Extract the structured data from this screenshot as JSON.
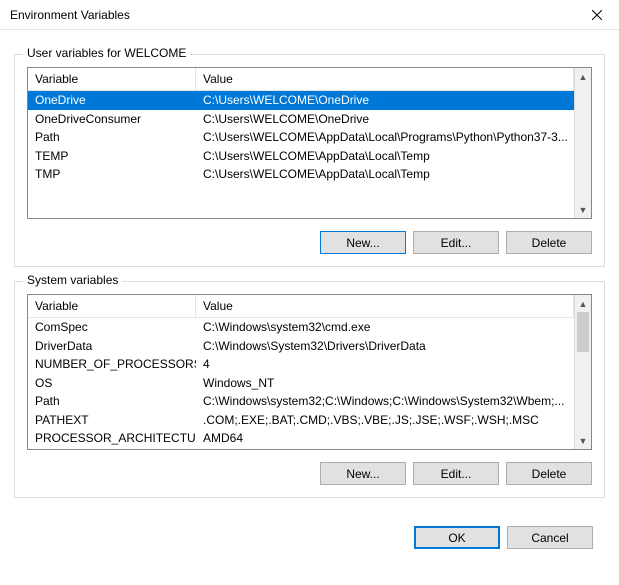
{
  "window": {
    "title": "Environment Variables"
  },
  "user": {
    "legend": "User variables for WELCOME",
    "header_var": "Variable",
    "header_val": "Value",
    "rows": [
      {
        "name": "OneDrive",
        "value": "C:\\Users\\WELCOME\\OneDrive"
      },
      {
        "name": "OneDriveConsumer",
        "value": "C:\\Users\\WELCOME\\OneDrive"
      },
      {
        "name": "Path",
        "value": "C:\\Users\\WELCOME\\AppData\\Local\\Programs\\Python\\Python37-3..."
      },
      {
        "name": "TEMP",
        "value": "C:\\Users\\WELCOME\\AppData\\Local\\Temp"
      },
      {
        "name": "TMP",
        "value": "C:\\Users\\WELCOME\\AppData\\Local\\Temp"
      }
    ],
    "buttons": {
      "new": "New...",
      "edit": "Edit...",
      "delete": "Delete"
    }
  },
  "system": {
    "legend": "System variables",
    "header_var": "Variable",
    "header_val": "Value",
    "rows": [
      {
        "name": "ComSpec",
        "value": "C:\\Windows\\system32\\cmd.exe"
      },
      {
        "name": "DriverData",
        "value": "C:\\Windows\\System32\\Drivers\\DriverData"
      },
      {
        "name": "NUMBER_OF_PROCESSORS",
        "value": "4"
      },
      {
        "name": "OS",
        "value": "Windows_NT"
      },
      {
        "name": "Path",
        "value": "C:\\Windows\\system32;C:\\Windows;C:\\Windows\\System32\\Wbem;..."
      },
      {
        "name": "PATHEXT",
        "value": ".COM;.EXE;.BAT;.CMD;.VBS;.VBE;.JS;.JSE;.WSF;.WSH;.MSC"
      },
      {
        "name": "PROCESSOR_ARCHITECTURE",
        "value": "AMD64"
      }
    ],
    "buttons": {
      "new": "New...",
      "edit": "Edit...",
      "delete": "Delete"
    }
  },
  "footer": {
    "ok": "OK",
    "cancel": "Cancel"
  }
}
